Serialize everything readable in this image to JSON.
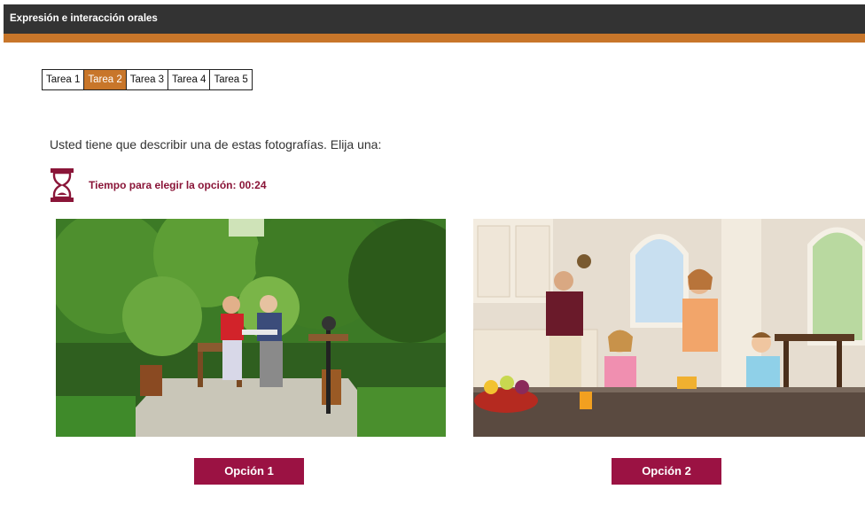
{
  "header": {
    "title": "Expresión e interacción orales"
  },
  "tabs": [
    {
      "label": "Tarea 1",
      "active": false
    },
    {
      "label": "Tarea 2",
      "active": true
    },
    {
      "label": "Tarea 3",
      "active": false
    },
    {
      "label": "Tarea 4",
      "active": false
    },
    {
      "label": "Tarea 5",
      "active": false
    }
  ],
  "instruction": "Usted tiene que describir una de estas fotografías. Elija una:",
  "timer": {
    "icon": "hourglass-icon",
    "label": "Tiempo para elegir la opción: 00:24"
  },
  "options": [
    {
      "label": "Opción 1",
      "photo": "garden-couple-photo"
    },
    {
      "label": "Opción 2",
      "photo": "kitchen-family-photo"
    }
  ],
  "colors": {
    "accent": "#c8762a",
    "header": "#333333",
    "button": "#9b1243",
    "timer": "#8a1538"
  }
}
